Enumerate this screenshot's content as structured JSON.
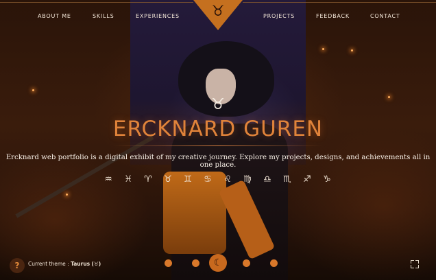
{
  "nav": {
    "left": [
      "ABOUT ME",
      "SKILLS",
      "EXPERIENCES"
    ],
    "right": [
      "PROJECTS",
      "FEEDBACK",
      "CONTACT"
    ],
    "emblem_icon": "taurus-icon"
  },
  "hero": {
    "icon": "taurus-icon",
    "title": "ERCKNARD GUREN",
    "description": "Ercknard web portfolio is a digital exhibit of my creative journey. Explore my projects, designs, and achievements all in one place.",
    "zodiac": [
      {
        "name": "aquarius-icon",
        "glyph": "♒"
      },
      {
        "name": "pisces-icon",
        "glyph": "♓"
      },
      {
        "name": "aries-icon",
        "glyph": "♈"
      },
      {
        "name": "taurus-icon",
        "glyph": "♉"
      },
      {
        "name": "gemini-icon",
        "glyph": "♊"
      },
      {
        "name": "cancer-icon",
        "glyph": "♋"
      },
      {
        "name": "leo-icon",
        "glyph": "♌"
      },
      {
        "name": "virgo-icon",
        "glyph": "♍"
      },
      {
        "name": "libra-icon",
        "glyph": "♎"
      },
      {
        "name": "scorpio-icon",
        "glyph": "♏"
      },
      {
        "name": "sagittarius-icon",
        "glyph": "♐"
      },
      {
        "name": "capricorn-icon",
        "glyph": "♑"
      }
    ]
  },
  "footer": {
    "help": "?",
    "theme_label": "Current theme :",
    "theme_value": "Taurus",
    "theme_glyph": "(♉)",
    "carousel_active_glyph": "☾"
  },
  "colors": {
    "accent": "#e0833a",
    "emblem": "#c5701f",
    "background": "#2a1409",
    "panel": "#241a3a"
  }
}
